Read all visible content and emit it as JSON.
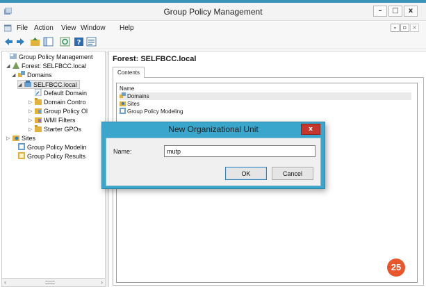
{
  "window": {
    "title": "Group Policy Management",
    "minimize": "–",
    "maximize": "□",
    "close": "x"
  },
  "menubar": {
    "items": [
      "File",
      "Action",
      "View",
      "Window",
      "Help"
    ],
    "mdi": {
      "minimize": "–",
      "restore": "▫",
      "close": "×"
    }
  },
  "toolbar": {
    "back_icon": "back-arrow-icon",
    "forward_icon": "forward-arrow-icon"
  },
  "tree": {
    "root": "Group Policy Management",
    "forest": "Forest: SELFBCC.local",
    "domains": "Domains",
    "domain": "SELFBCC.local",
    "children": [
      "Default Domain",
      "Domain Contro",
      "Group Policy Ol",
      "WMI Filters",
      "Starter GPOs"
    ],
    "sites": "Sites",
    "modeling": "Group Policy Modelin",
    "results": "Group Policy Results"
  },
  "content": {
    "title": "Forest: SELFBCC.local",
    "tab": "Contents",
    "column_header": "Name",
    "rows": [
      "Domains",
      "Sites",
      "Group Policy Modeling"
    ]
  },
  "dialog": {
    "title": "New Organizational Unit",
    "close": "x",
    "name_label": "Name:",
    "name_value": "mutp",
    "ok_label": "OK",
    "cancel_label": "Cancel"
  },
  "badge": {
    "step": "25"
  },
  "colors": {
    "accent": "#3aa6cc",
    "close_red": "#c6362c",
    "badge": "#e8572b"
  }
}
